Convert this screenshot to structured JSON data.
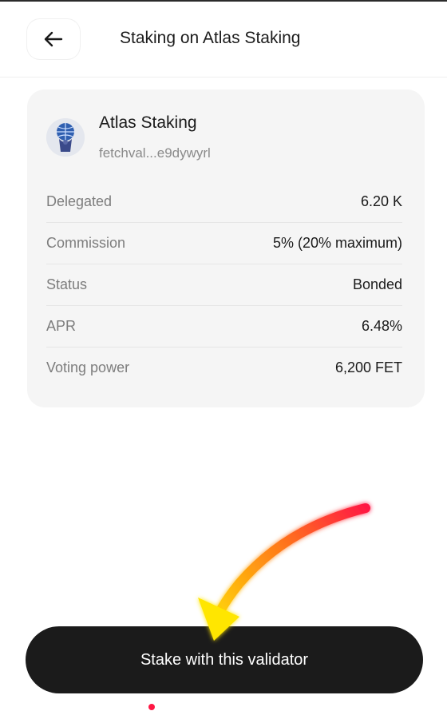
{
  "header": {
    "title": "Staking on Atlas Staking"
  },
  "validator": {
    "name": "Atlas Staking",
    "address": "fetchval...e9dywyrl",
    "avatar_icon": "atlas-globe-logo"
  },
  "details": [
    {
      "label": "Delegated",
      "value": "6.20 K"
    },
    {
      "label": "Commission",
      "value": "5% (20% maximum)"
    },
    {
      "label": "Status",
      "value": "Bonded"
    },
    {
      "label": "APR",
      "value": "6.48%"
    },
    {
      "label": "Voting power",
      "value": "6,200 FET"
    }
  ],
  "actions": {
    "stake_label": "Stake with this validator"
  },
  "colors": {
    "card_bg": "#f5f5f5",
    "button_bg": "#1b1b1b",
    "arrow_gradient": [
      "#ff1744",
      "#ff7a1a",
      "#ffe600"
    ]
  }
}
